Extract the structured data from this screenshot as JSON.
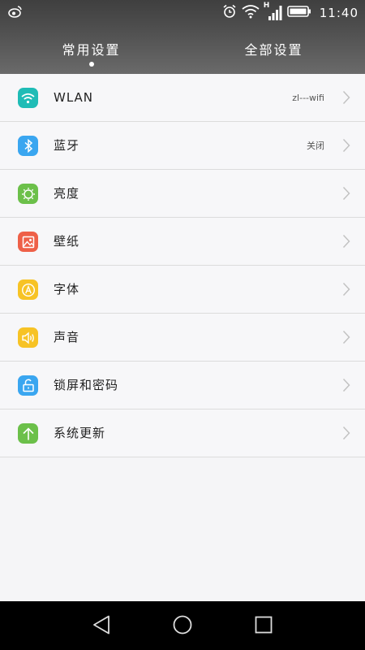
{
  "status_bar": {
    "time": "11:40",
    "network_label": "H",
    "icons": [
      "weibo-icon",
      "alarm-icon",
      "wifi-icon",
      "signal-icon",
      "battery-icon"
    ]
  },
  "tabs": [
    {
      "label": "常用设置",
      "selected": true
    },
    {
      "label": "全部设置",
      "selected": false
    }
  ],
  "settings": [
    {
      "label": "WLAN",
      "value": "zl---wifi",
      "icon": "wifi-icon",
      "color": "#1fbcb6"
    },
    {
      "label": "蓝牙",
      "value": "关闭",
      "icon": "bluetooth-icon",
      "color": "#3aa6f0"
    },
    {
      "label": "亮度",
      "value": "",
      "icon": "brightness-icon",
      "color": "#6cc04a"
    },
    {
      "label": "壁纸",
      "value": "",
      "icon": "wallpaper-icon",
      "color": "#ee6048"
    },
    {
      "label": "字体",
      "value": "",
      "icon": "font-icon",
      "color": "#f7c325"
    },
    {
      "label": "声音",
      "value": "",
      "icon": "sound-icon",
      "color": "#f7c325"
    },
    {
      "label": "锁屏和密码",
      "value": "",
      "icon": "lock-icon",
      "color": "#3aa6f0"
    },
    {
      "label": "系统更新",
      "value": "",
      "icon": "update-icon",
      "color": "#6cc04a"
    }
  ],
  "nav_bar": {
    "icons": [
      "back-icon",
      "home-icon",
      "recent-apps-icon"
    ]
  }
}
